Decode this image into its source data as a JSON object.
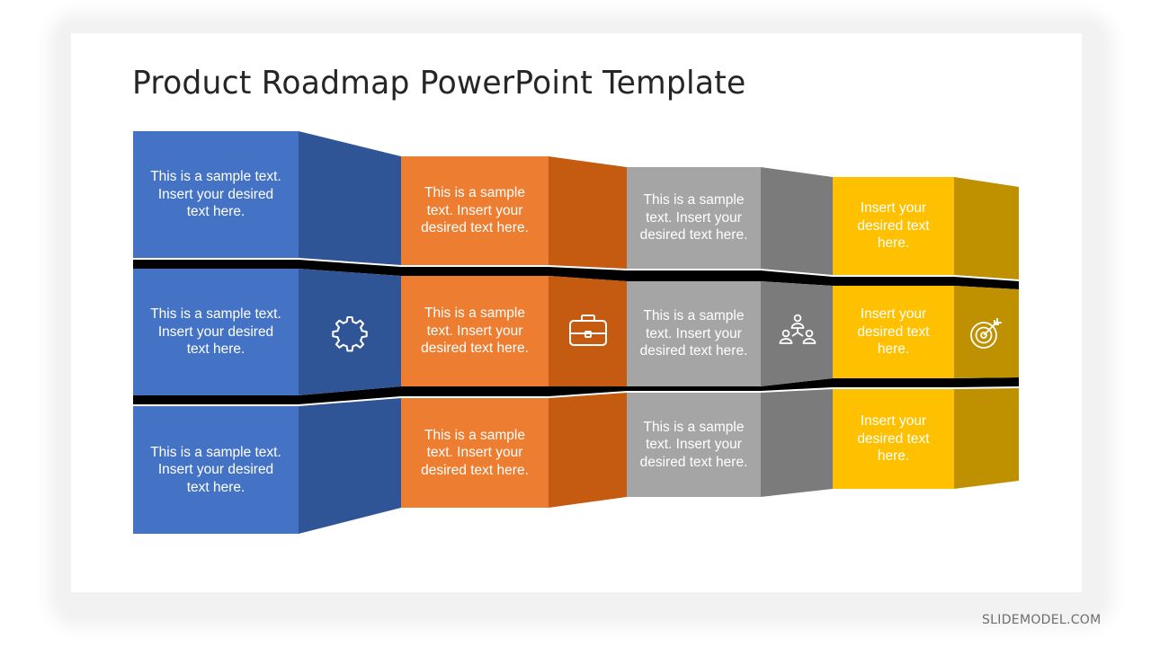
{
  "slide": {
    "title": "Product Roadmap PowerPoint Template",
    "watermark": "SLIDEMODEL.COM"
  },
  "colors": {
    "blue_front": "#4472C4",
    "blue_side": "#2F5597",
    "orange_front": "#ED7D31",
    "orange_side": "#C55A11",
    "gray_front": "#A5A5A5",
    "gray_side": "#7B7B7B",
    "yellow_front": "#FFC000",
    "yellow_side": "#BF9000",
    "gap": "#000000"
  },
  "columns": [
    {
      "name": "blue",
      "icon": "gear-icon",
      "cells": [
        "This is a sample text. Insert your desired text here.",
        "This is a sample text. Insert your desired text here.",
        "This is a sample text. Insert your desired text here."
      ]
    },
    {
      "name": "orange",
      "icon": "briefcase-icon",
      "cells": [
        "This is a sample text. Insert your desired text here.",
        "This is a sample text. Insert your desired text here.",
        "This is a sample text. Insert your desired text here."
      ]
    },
    {
      "name": "gray",
      "icon": "team-hierarchy-icon",
      "cells": [
        "This is a sample text. Insert your desired text here.",
        "This is a sample text. Insert your desired text here.",
        "This is a sample text. Insert your desired text here."
      ]
    },
    {
      "name": "yellow",
      "icon": "target-icon",
      "cells": [
        "Insert your desired text here.",
        "Insert your desired text here.",
        "Insert your desired text here."
      ]
    }
  ]
}
